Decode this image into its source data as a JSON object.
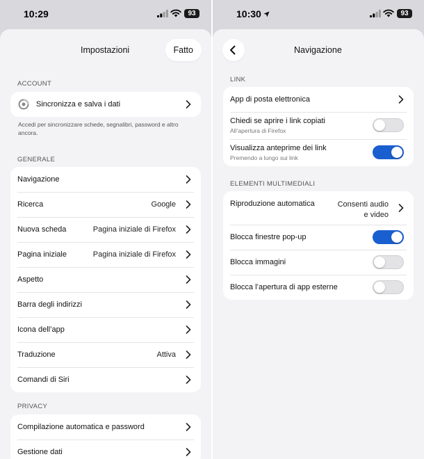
{
  "left": {
    "status": {
      "time": "10:29",
      "battery": "93"
    },
    "header": {
      "title": "Impostazioni",
      "done_label": "Fatto"
    },
    "account": {
      "section_label": "ACCOUNT",
      "sync_label": "Sincronizza e salva i dati",
      "sync_icon": "firefox-sync-icon",
      "hint": "Accedi per sincronizzare schede, segnalibri, password e altro ancora."
    },
    "generale": {
      "section_label": "GENERALE",
      "items": [
        {
          "label": "Navigazione",
          "value": ""
        },
        {
          "label": "Ricerca",
          "value": "Google"
        },
        {
          "label": "Nuova scheda",
          "value": "Pagina iniziale di Firefox"
        },
        {
          "label": "Pagina iniziale",
          "value": "Pagina iniziale di Firefox"
        },
        {
          "label": "Aspetto",
          "value": ""
        },
        {
          "label": "Barra degli indirizzi",
          "value": ""
        },
        {
          "label": "Icona dell’app",
          "value": ""
        },
        {
          "label": "Traduzione",
          "value": "Attiva"
        },
        {
          "label": "Comandi di Siri",
          "value": ""
        }
      ]
    },
    "privacy": {
      "section_label": "PRIVACY",
      "items": [
        {
          "label": "Compilazione automatica e password",
          "value": ""
        },
        {
          "label": "Gestione dati",
          "value": ""
        }
      ]
    }
  },
  "right": {
    "status": {
      "time": "10:30",
      "battery": "93"
    },
    "header": {
      "title": "Navigazione"
    },
    "link": {
      "section_label": "LINK",
      "items": [
        {
          "label": "App di posta elettronica",
          "sub": "",
          "type": "chevron"
        },
        {
          "label": "Chiedi se aprire i link copiati",
          "sub": "All’apertura di Firefox",
          "type": "toggle",
          "on": false
        },
        {
          "label": "Visualizza anteprime dei link",
          "sub": "Premendo a lungo sui link",
          "type": "toggle",
          "on": true
        }
      ]
    },
    "media": {
      "section_label": "ELEMENTI MULTIMEDIALI",
      "autoplay_label": "Riproduzione automatica",
      "autoplay_value_line1": "Consenti audio",
      "autoplay_value_line2": "e video",
      "items": [
        {
          "label": "Blocca finestre pop-up",
          "on": true
        },
        {
          "label": "Blocca immagini",
          "on": false
        },
        {
          "label": "Blocca l’apertura di app esterne",
          "on": false
        }
      ]
    }
  },
  "colors": {
    "toggle_on": "#1a5fcf",
    "background": "#f3f3f6",
    "card": "#ffffff"
  }
}
